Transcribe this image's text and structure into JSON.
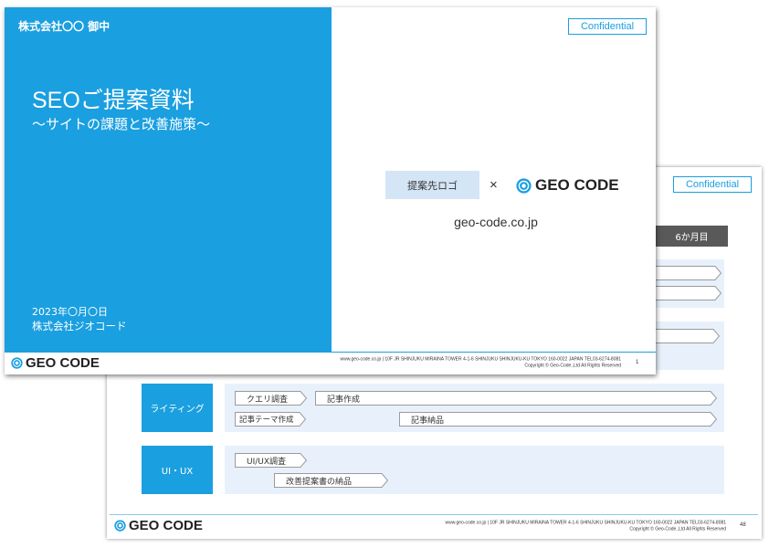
{
  "colors": {
    "brand_blue": "#1a9fe0",
    "row_background": "#e8f1fb",
    "header_gray": "#595959",
    "client_logo_box": "#d4e5f6"
  },
  "icons": {
    "logo": "geo-code-logo-icon"
  },
  "front_slide": {
    "addressee": "株式会社〇〇 御中",
    "title": "SEOご提案資料",
    "subtitle": "～サイトの課題と改善施策～",
    "date": "2023年〇月〇日",
    "company": "株式会社ジオコード",
    "confidential": "Confidential",
    "client_logo_placeholder": "提案先ロゴ",
    "times": "×",
    "logo_text": "GEO CODE",
    "url": "geo-code.co.jp",
    "footer_address": "www.geo-code.co.jp  |  10F JR SHINJUKU MIRAINA TOWER 4-1-6 SHINJUKU SHINJUKU-KU TOKYO 160-0022  JAPAN  TEL03-6274-8081",
    "footer_copyright": "Copyright © Geo-Code.,Ltd All Rights Reserved",
    "page_number": "1"
  },
  "back_slide": {
    "confidential": "Confidential",
    "column_header": "6か月目",
    "rows": [
      {
        "label": "ライティング",
        "tasks": [
          "クエリ調査",
          "記事作成",
          "記事テーマ作成",
          "記事納品"
        ]
      },
      {
        "label": "UI・UX",
        "tasks": [
          "UI/UX調査",
          "改善提案書の納品"
        ]
      }
    ],
    "logo_text": "GEO CODE",
    "footer_address": "www.geo-code.co.jp  |  10F JR SHINJUKU MIRAINA TOWER 4-1-6 SHINJUKU SHINJUKU-KU TOKYO 160-0022  JAPAN  TEL03-6274-8081",
    "footer_copyright": "Copyright © Geo-Code.,Ltd All Rights Reserved",
    "page_number": "48"
  }
}
